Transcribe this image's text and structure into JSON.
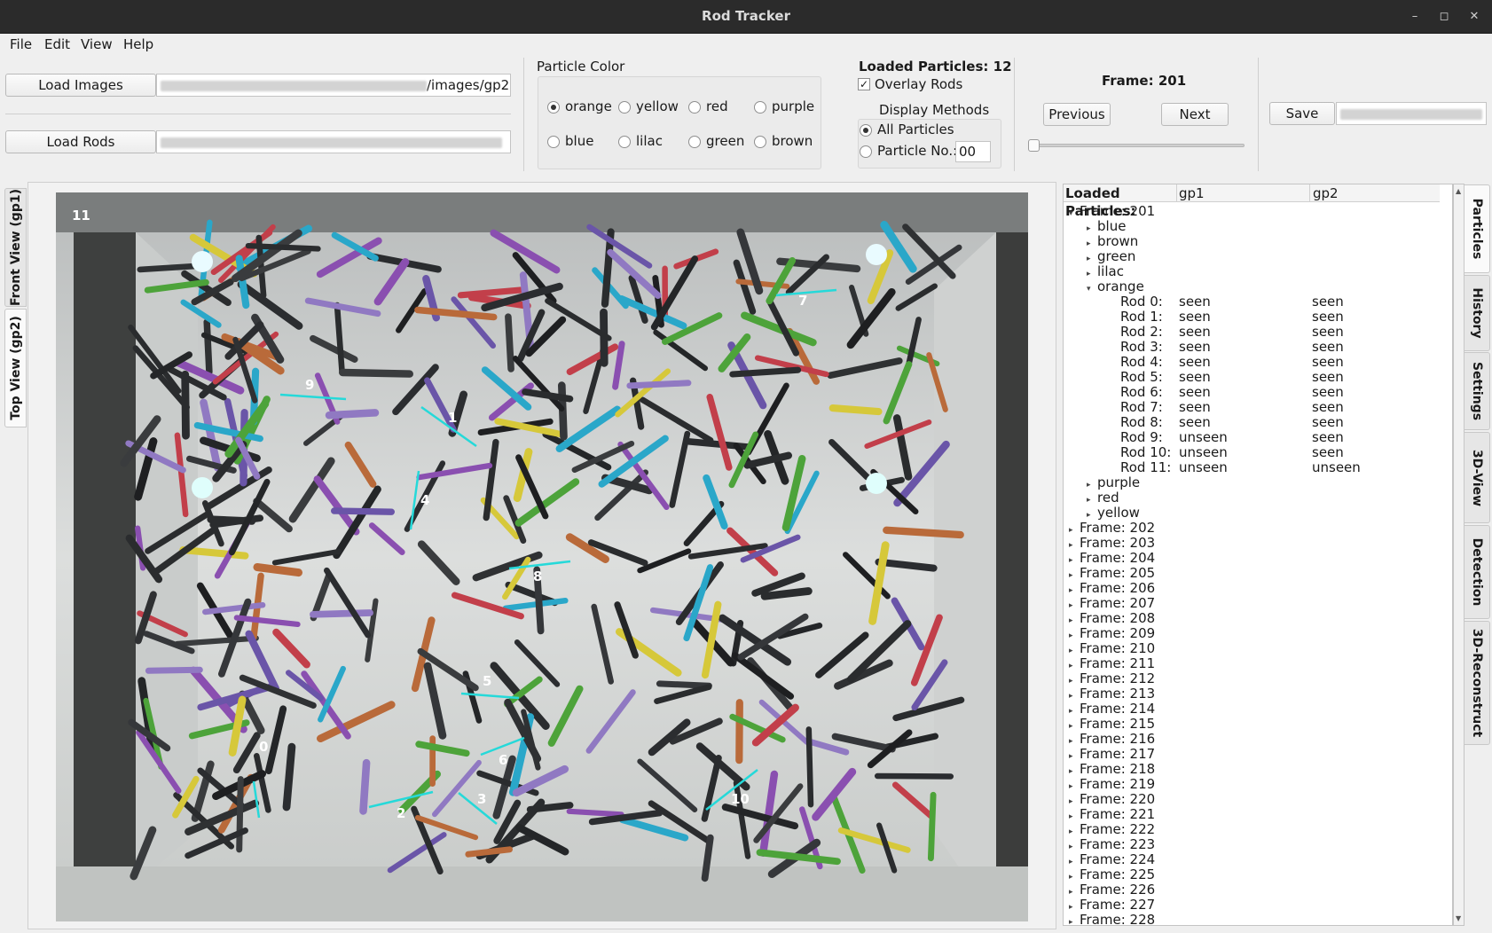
{
  "window": {
    "title": "Rod Tracker",
    "minimize": "–",
    "maximize": "◻",
    "close": "✕"
  },
  "menu": [
    "File",
    "Edit",
    "View",
    "Help"
  ],
  "load": {
    "images_button": "Load Images",
    "images_path": "/images/gp2",
    "rods_button": "Load Rods"
  },
  "particle_color": {
    "title": "Particle Color",
    "options": [
      "orange",
      "yellow",
      "red",
      "purple",
      "blue",
      "lilac",
      "green",
      "brown"
    ],
    "selected": "orange"
  },
  "display": {
    "loaded_particles": "Loaded Particles: 12",
    "overlay_label": "Overlay Rods",
    "overlay_checked": true,
    "methods_title": "Display Methods",
    "all_particles": "All Particles",
    "particle_no_label": "Particle No.:",
    "particle_no_value": "00"
  },
  "frame": {
    "label": "Frame: 201",
    "previous": "Previous",
    "next": "Next",
    "slider_value": 0
  },
  "save": {
    "button": "Save"
  },
  "left_tabs": [
    "Front View (gp1)",
    "Top View (gp2)"
  ],
  "right_tabs": [
    "Particles",
    "History",
    "Settings",
    "3D-View",
    "Detection",
    "3D-Reconstruct"
  ],
  "image": {
    "corner_label": "11",
    "rod_labels": [
      "0",
      "1",
      "2",
      "3",
      "4",
      "5",
      "6",
      "7",
      "8",
      "9",
      "10"
    ],
    "overlay_color": "#25d9d9"
  },
  "tree": {
    "header": [
      "Loaded Particles:",
      "gp1",
      "gp2"
    ],
    "expanded_frame": "Frame: 201",
    "colors_before": [
      "blue",
      "brown",
      "green",
      "lilac"
    ],
    "expanded_color": "orange",
    "rods": [
      {
        "name": "Rod  0:",
        "gp1": "seen",
        "gp2": "seen"
      },
      {
        "name": "Rod  1:",
        "gp1": "seen",
        "gp2": "seen"
      },
      {
        "name": "Rod  2:",
        "gp1": "seen",
        "gp2": "seen"
      },
      {
        "name": "Rod  3:",
        "gp1": "seen",
        "gp2": "seen"
      },
      {
        "name": "Rod  4:",
        "gp1": "seen",
        "gp2": "seen"
      },
      {
        "name": "Rod  5:",
        "gp1": "seen",
        "gp2": "seen"
      },
      {
        "name": "Rod  6:",
        "gp1": "seen",
        "gp2": "seen"
      },
      {
        "name": "Rod  7:",
        "gp1": "seen",
        "gp2": "seen"
      },
      {
        "name": "Rod  8:",
        "gp1": "seen",
        "gp2": "seen"
      },
      {
        "name": "Rod  9:",
        "gp1": "unseen",
        "gp2": "seen"
      },
      {
        "name": "Rod 10:",
        "gp1": "unseen",
        "gp2": "seen"
      },
      {
        "name": "Rod 11:",
        "gp1": "unseen",
        "gp2": "unseen"
      }
    ],
    "colors_after": [
      "purple",
      "red",
      "yellow"
    ],
    "frames": [
      "Frame: 202",
      "Frame: 203",
      "Frame: 204",
      "Frame: 205",
      "Frame: 206",
      "Frame: 207",
      "Frame: 208",
      "Frame: 209",
      "Frame: 210",
      "Frame: 211",
      "Frame: 212",
      "Frame: 213",
      "Frame: 214",
      "Frame: 215",
      "Frame: 216",
      "Frame: 217",
      "Frame: 218",
      "Frame: 219",
      "Frame: 220",
      "Frame: 221",
      "Frame: 222",
      "Frame: 223",
      "Frame: 224",
      "Frame: 225",
      "Frame: 226",
      "Frame: 227",
      "Frame: 228"
    ]
  }
}
